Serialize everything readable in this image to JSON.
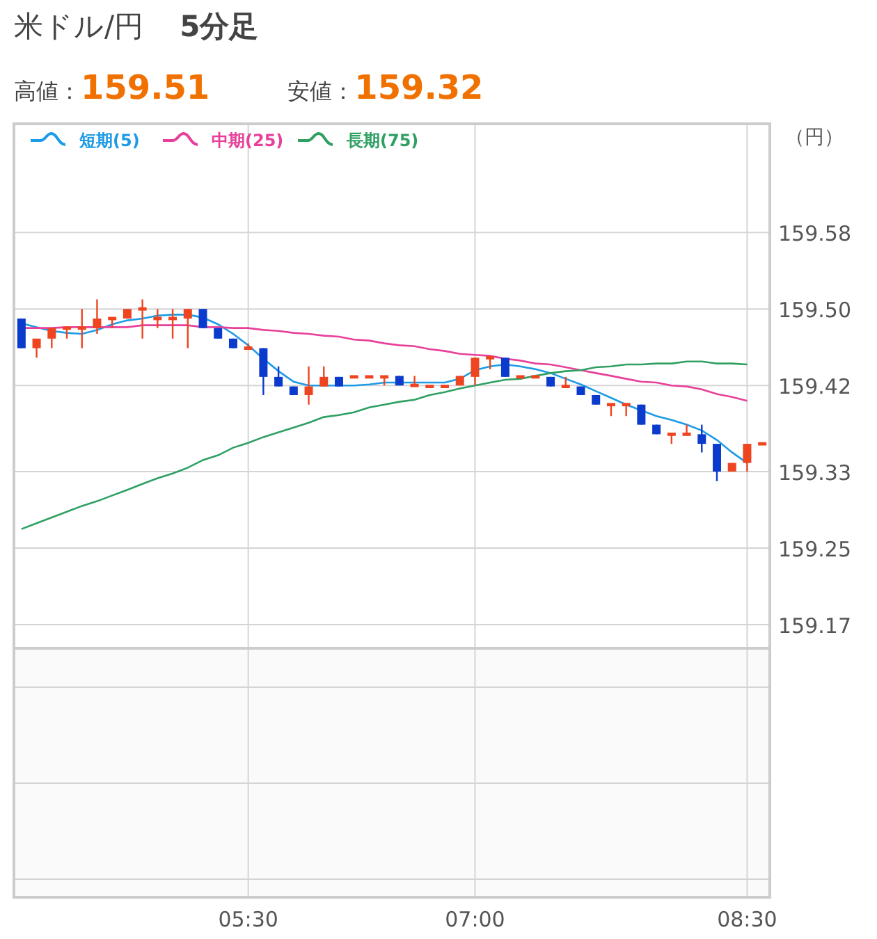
{
  "title": {
    "pair": "米ドル/円",
    "interval": "5分足"
  },
  "stats": [
    {
      "label": "高値：",
      "value": "159.51"
    },
    {
      "label": "安値：",
      "value": "159.32"
    }
  ],
  "chart": {
    "unit": "（円）",
    "chart_data": {
      "type": "candlestick",
      "categories": [
        null,
        null,
        null,
        null,
        null,
        null,
        null,
        null,
        null,
        null,
        null,
        null,
        null,
        null,
        null,
        "05:30",
        null,
        null,
        null,
        null,
        null,
        null,
        null,
        null,
        null,
        null,
        null,
        null,
        null,
        null,
        "07:00",
        null,
        null,
        null,
        null,
        null,
        null,
        null,
        null,
        null,
        null,
        null,
        null,
        null,
        null,
        null,
        null,
        null,
        "08:30",
        null
      ],
      "grid": true,
      "legend": "upper left",
      "ylim": [
        158.885,
        159.695
      ],
      "yticks": [
        159.58,
        {
          "value": 159.5,
          "label": "159.50"
        },
        159.42,
        159.33,
        159.25,
        159.17
      ],
      "ohlc": [
        [
          159.49,
          159.49,
          159.459,
          159.459
        ],
        [
          159.459,
          159.469,
          159.449,
          159.469
        ],
        [
          159.469,
          159.48,
          159.459,
          159.48
        ],
        [
          159.48,
          159.48,
          159.469,
          159.48
        ],
        [
          159.48,
          159.5,
          159.459,
          159.48
        ],
        [
          159.48,
          159.51,
          159.474,
          159.49
        ],
        [
          159.49,
          159.49,
          159.48,
          159.49
        ],
        [
          159.49,
          159.5,
          159.49,
          159.5
        ],
        [
          159.5,
          159.51,
          159.469,
          159.5
        ],
        [
          159.49,
          159.5,
          159.48,
          159.49
        ],
        [
          159.49,
          159.5,
          159.469,
          159.49
        ],
        [
          159.49,
          159.5,
          159.459,
          159.5
        ],
        [
          159.5,
          159.5,
          159.48,
          159.48
        ],
        [
          159.48,
          159.48,
          159.469,
          159.469
        ],
        [
          159.469,
          159.469,
          159.459,
          159.459
        ],
        [
          159.459,
          159.464,
          159.459,
          159.459
        ],
        [
          159.459,
          159.459,
          159.41,
          159.429
        ],
        [
          159.429,
          159.44,
          159.419,
          159.419
        ],
        [
          159.419,
          159.419,
          159.41,
          159.41
        ],
        [
          159.41,
          159.44,
          159.4,
          159.419
        ],
        [
          159.419,
          159.44,
          159.419,
          159.429
        ],
        [
          159.429,
          159.429,
          159.419,
          159.419
        ],
        [
          159.429,
          159.429,
          159.429,
          159.429
        ],
        [
          159.429,
          159.429,
          159.429,
          159.429
        ],
        [
          159.429,
          159.429,
          159.42,
          159.429
        ],
        [
          159.43,
          159.43,
          159.42,
          159.42
        ],
        [
          159.42,
          159.43,
          159.42,
          159.42
        ],
        [
          159.419,
          159.419,
          159.419,
          159.419
        ],
        [
          159.419,
          159.419,
          159.419,
          159.419
        ],
        [
          159.42,
          159.43,
          159.42,
          159.43
        ],
        [
          159.429,
          159.449,
          159.42,
          159.449
        ],
        [
          159.449,
          159.449,
          159.437,
          159.449
        ],
        [
          159.449,
          159.449,
          159.429,
          159.429
        ],
        [
          159.429,
          159.429,
          159.429,
          159.429
        ],
        [
          159.429,
          159.429,
          159.429,
          159.429
        ],
        [
          159.429,
          159.429,
          159.419,
          159.419
        ],
        [
          159.419,
          159.429,
          159.419,
          159.419
        ],
        [
          159.419,
          159.419,
          159.41,
          159.41
        ],
        [
          159.41,
          159.41,
          159.4,
          159.4
        ],
        [
          159.4,
          159.4,
          159.388,
          159.4
        ],
        [
          159.4,
          159.4,
          159.388,
          159.4
        ],
        [
          159.4,
          159.4,
          159.379,
          159.379
        ],
        [
          159.379,
          159.379,
          159.369,
          159.369
        ],
        [
          159.369,
          159.369,
          159.359,
          159.369
        ],
        [
          159.369,
          159.379,
          159.369,
          159.369
        ],
        [
          159.369,
          159.379,
          159.35,
          159.359
        ],
        [
          159.359,
          159.359,
          159.32,
          159.33
        ],
        [
          159.33,
          159.339,
          159.33,
          159.339
        ],
        [
          159.339,
          159.359,
          159.33,
          159.359
        ],
        [
          159.359,
          159.359,
          159.359,
          159.359
        ]
      ],
      "series": [
        {
          "name": "短期(5)",
          "type": "line",
          "color": "#1e9be6",
          "values": [
            159.485,
            159.481,
            159.477,
            159.475,
            159.474,
            159.478,
            159.484,
            159.488,
            159.49,
            159.493,
            159.494,
            159.494,
            159.491,
            159.484,
            159.474,
            159.462,
            159.448,
            159.435,
            159.424,
            159.42,
            159.42,
            159.42,
            159.42,
            159.421,
            159.423,
            159.423,
            159.423,
            159.423,
            159.423,
            159.427,
            159.436,
            159.44,
            159.442,
            159.44,
            159.437,
            159.433,
            159.427,
            159.421,
            159.414,
            159.407,
            159.4,
            159.394,
            159.388,
            159.384,
            159.379,
            159.373,
            159.363,
            159.35,
            159.339,
            null
          ]
        },
        {
          "name": "中期(25)",
          "type": "line",
          "color": "#e8409a",
          "values": [
            159.48,
            159.48,
            159.48,
            159.481,
            159.481,
            159.481,
            159.481,
            159.481,
            159.483,
            159.483,
            159.483,
            159.483,
            159.481,
            159.481,
            159.48,
            159.48,
            159.478,
            159.477,
            159.475,
            159.474,
            159.472,
            159.471,
            159.468,
            159.467,
            159.464,
            159.462,
            159.461,
            159.458,
            159.456,
            159.453,
            159.452,
            159.451,
            159.448,
            159.446,
            159.443,
            159.442,
            159.439,
            159.436,
            159.433,
            159.43,
            159.427,
            159.424,
            159.423,
            159.42,
            159.419,
            159.416,
            159.411,
            159.408,
            159.404,
            null
          ]
        },
        {
          "name": "長期(75)",
          "type": "line",
          "color": "#2fa062",
          "values": [
            159.27,
            159.276,
            159.282,
            159.288,
            159.294,
            159.299,
            159.305,
            159.311,
            159.317,
            159.323,
            159.328,
            159.334,
            159.342,
            159.347,
            159.355,
            159.36,
            159.366,
            159.371,
            159.376,
            159.381,
            159.387,
            159.389,
            159.392,
            159.397,
            159.4,
            159.403,
            159.405,
            159.41,
            159.413,
            159.417,
            159.42,
            159.423,
            159.426,
            159.427,
            159.43,
            159.433,
            159.435,
            159.436,
            159.439,
            159.44,
            159.442,
            159.442,
            159.443,
            159.443,
            159.445,
            159.445,
            159.443,
            159.443,
            159.442,
            null
          ]
        }
      ]
    }
  }
}
